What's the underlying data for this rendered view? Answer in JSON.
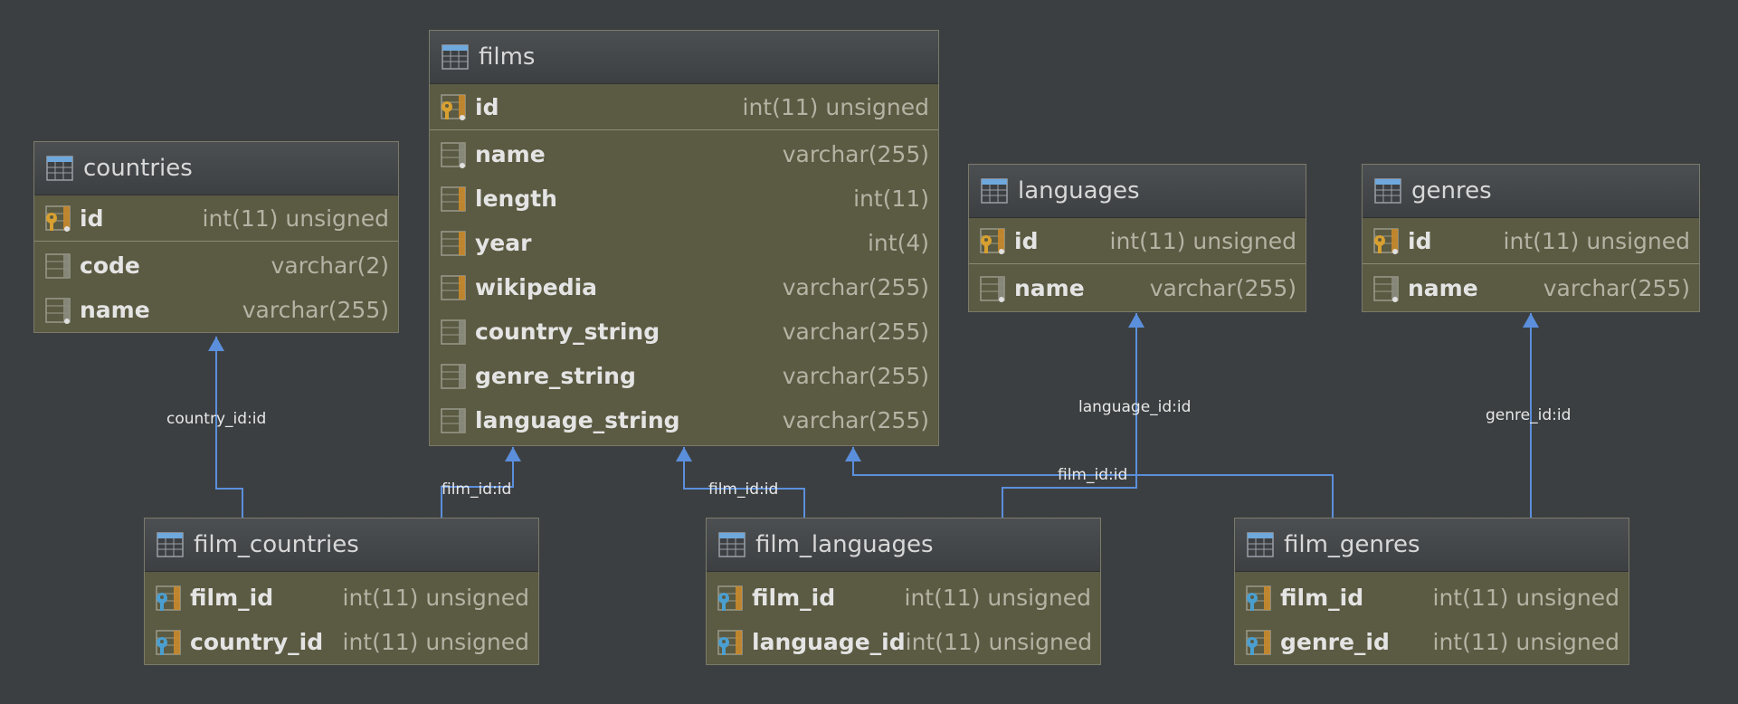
{
  "tables": {
    "films": {
      "title": "films",
      "columns": [
        {
          "name": "id",
          "type": "int(11) unsigned",
          "icon": "primary-key-icon"
        },
        {
          "name": "name",
          "type": "varchar(255)",
          "icon": "column-dot-icon"
        },
        {
          "name": "length",
          "type": "int(11)",
          "icon": "column-orange-icon"
        },
        {
          "name": "year",
          "type": "int(4)",
          "icon": "column-orange-icon"
        },
        {
          "name": "wikipedia",
          "type": "varchar(255)",
          "icon": "column-orange-icon"
        },
        {
          "name": "country_string",
          "type": "varchar(255)",
          "icon": "column-icon"
        },
        {
          "name": "genre_string",
          "type": "varchar(255)",
          "icon": "column-icon"
        },
        {
          "name": "language_string",
          "type": "varchar(255)",
          "icon": "column-icon"
        }
      ]
    },
    "countries": {
      "title": "countries",
      "columns": [
        {
          "name": "id",
          "type": "int(11) unsigned",
          "icon": "primary-key-icon"
        },
        {
          "name": "code",
          "type": "varchar(2)",
          "icon": "column-icon"
        },
        {
          "name": "name",
          "type": "varchar(255)",
          "icon": "column-dot-icon"
        }
      ]
    },
    "languages": {
      "title": "languages",
      "columns": [
        {
          "name": "id",
          "type": "int(11) unsigned",
          "icon": "primary-key-icon"
        },
        {
          "name": "name",
          "type": "varchar(255)",
          "icon": "column-dot-icon"
        }
      ]
    },
    "genres": {
      "title": "genres",
      "columns": [
        {
          "name": "id",
          "type": "int(11) unsigned",
          "icon": "primary-key-icon"
        },
        {
          "name": "name",
          "type": "varchar(255)",
          "icon": "column-dot-icon"
        }
      ]
    },
    "film_countries": {
      "title": "film_countries",
      "columns": [
        {
          "name": "film_id",
          "type": "int(11) unsigned",
          "icon": "foreign-key-icon"
        },
        {
          "name": "country_id",
          "type": "int(11) unsigned",
          "icon": "foreign-key-icon"
        }
      ]
    },
    "film_languages": {
      "title": "film_languages",
      "columns": [
        {
          "name": "film_id",
          "type": "int(11) unsigned",
          "icon": "foreign-key-icon"
        },
        {
          "name": "language_id",
          "type": "int(11) unsigned",
          "icon": "foreign-key-icon"
        }
      ]
    },
    "film_genres": {
      "title": "film_genres",
      "columns": [
        {
          "name": "film_id",
          "type": "int(11) unsigned",
          "icon": "foreign-key-icon"
        },
        {
          "name": "genre_id",
          "type": "int(11) unsigned",
          "icon": "foreign-key-icon"
        }
      ]
    }
  },
  "links": {
    "country": "country_id:id",
    "language": "language_id:id",
    "genre": "genre_id:id",
    "film_countries": "film_id:id",
    "film_languages": "film_id:id",
    "film_genres": "film_id:id"
  },
  "colors": {
    "background": "#3c3f41",
    "table_body": "#5b5a42",
    "link_line": "#5b8fdc"
  }
}
